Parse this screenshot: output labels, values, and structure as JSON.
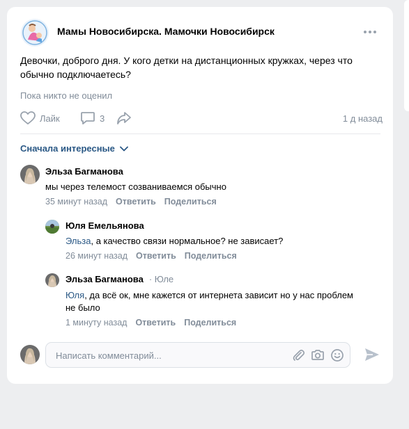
{
  "post": {
    "group_name": "Мамы Новосибирска. Мамочки Новосибирск",
    "text": "Девочки, доброго дня. У кого детки на дистанционных кружках, через что обычно подключаетесь?",
    "likes_status": "Пока никто не оценил",
    "like_label": "Лайк",
    "comments_count": "3",
    "time": "1 д назад"
  },
  "comments_section": {
    "sort_label": "Сначала интересные"
  },
  "comments": [
    {
      "author": "Эльза Багманова",
      "text": "мы через телемост созваниваемся обычно",
      "time": "35 минут назад",
      "reply": "Ответить",
      "share": "Поделиться"
    },
    {
      "author": "Юля Емельянова",
      "mention": "Эльза",
      "text": ", а качество связи нормальное? не зависает?",
      "time": "26 минут назад",
      "reply": "Ответить",
      "share": "Поделиться"
    },
    {
      "author": "Эльза Багманова",
      "reply_to": "· Юле",
      "mention": "Юля",
      "text": ", да всё ок, мне кажется от интернета зависит но у нас проблем не было",
      "time": "1 минуту назад",
      "reply": "Ответить",
      "share": "Поделиться"
    }
  ],
  "compose": {
    "placeholder": "Написать комментарий..."
  },
  "colors": {
    "link": "#2a5885",
    "secondary": "#818c99",
    "background": "#edeef0"
  }
}
